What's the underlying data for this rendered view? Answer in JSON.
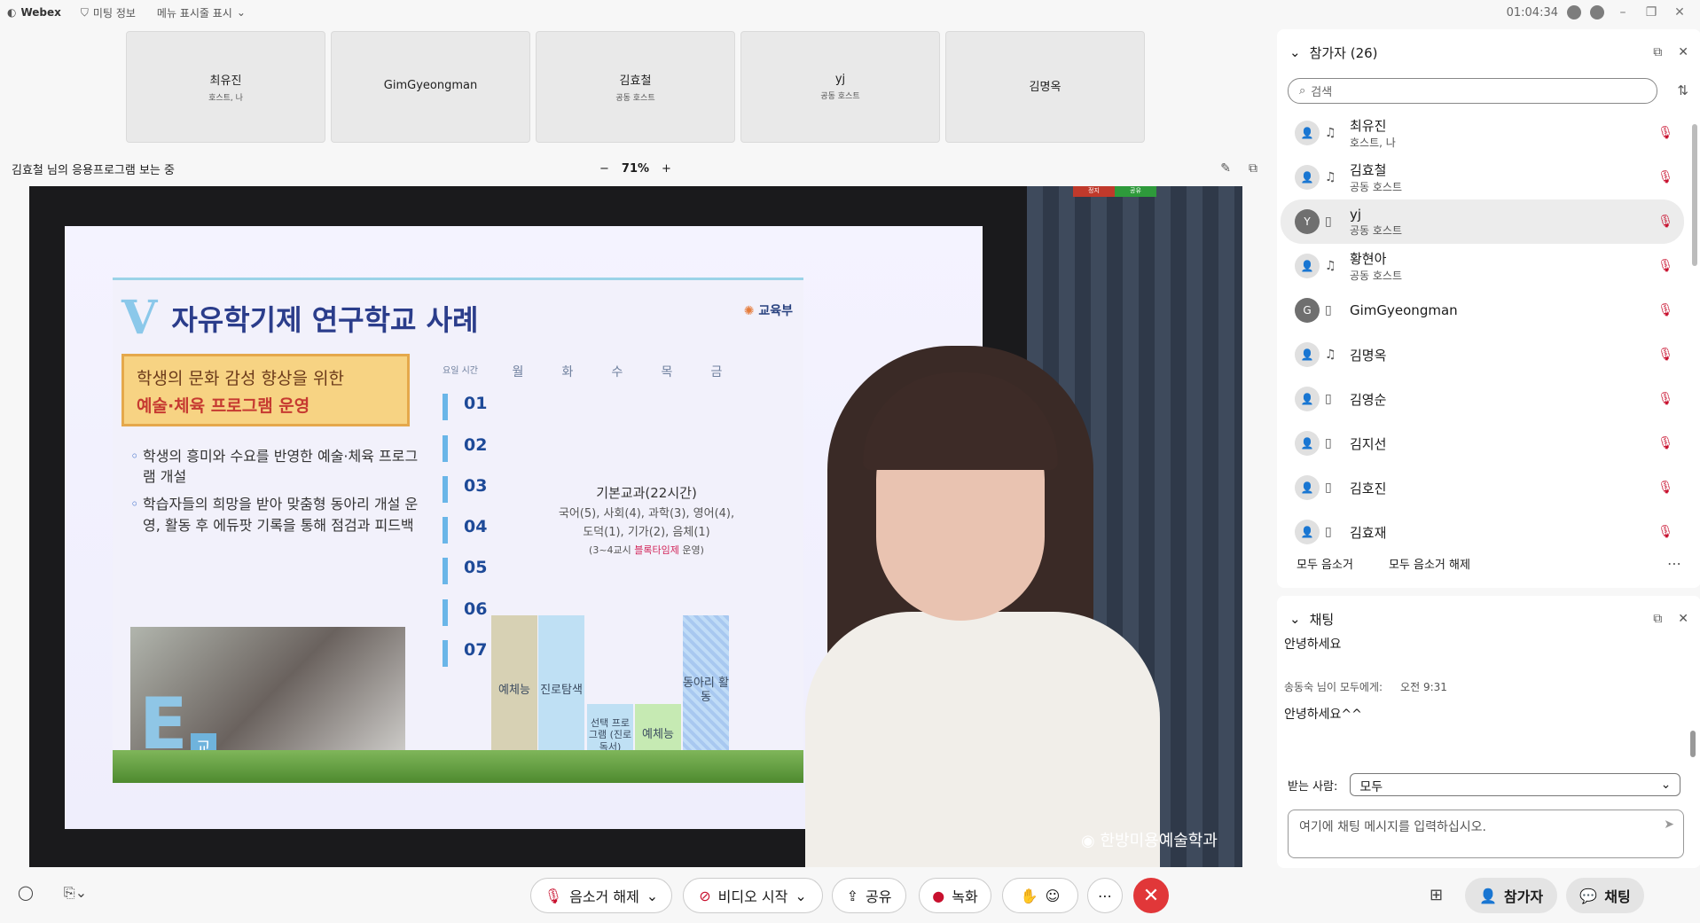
{
  "titlebar": {
    "app": "Webex",
    "meeting_info": "미팅 정보",
    "menu": "메뉴 표시줄 표시",
    "time": "01:04:34"
  },
  "tiles": [
    {
      "name": "최유진",
      "role": "호스트, 나"
    },
    {
      "name": "GimGyeongman",
      "role": ""
    },
    {
      "name": "김효철",
      "role": "공동 호스트"
    },
    {
      "name": "yj",
      "role": "공동 호스트"
    },
    {
      "name": "김명옥",
      "role": ""
    }
  ],
  "share": {
    "title": "김효철 님의 응용프로그램 보는 중",
    "zoom_minus": "−",
    "zoom": "71%",
    "zoom_plus": "+"
  },
  "slide": {
    "v": "V",
    "heading": "자유학기제 연구학교 사례",
    "logo": "교육부",
    "box_line1": "학생의 문화 감성 향상을 위한",
    "box_line2": "예술·체육 프로그램 운영",
    "bullets": [
      "학생의 흥미와 수요를 반영한 예술·체육 프로그램 개설",
      "학습자들의 희망을 받아 맞춤형 동아리 개설 운영, 활동 후 에듀팟 기록을 통해 점검과 피드백"
    ],
    "grid_corner": "요일 시간",
    "days": [
      "월",
      "화",
      "수",
      "목",
      "금"
    ],
    "periods": [
      "01",
      "02",
      "03",
      "04",
      "05",
      "06",
      "07"
    ],
    "core_title": "기본교과(22시간)",
    "core_line1": "국어(5), 사회(4), 과학(3), 영어(4),",
    "core_line2": "도덕(1), 기가(2), 음체(1)",
    "core_note_a": "(3~4교시 ",
    "core_note_red": "블록타임제",
    "core_note_b": " 운영)",
    "blocks": [
      "예체능",
      "진로탐색",
      "선택 프로그램 (진로독서)",
      "예체능",
      "동아리 활동"
    ],
    "photo_letter": "E",
    "photo_badge": "교"
  },
  "recording_mini": [
    "정지",
    "공유"
  ],
  "caption": "한방미용예술학과",
  "participants": {
    "header": "참가자 (26)",
    "search_placeholder": "검색",
    "list": [
      {
        "name": "최유진",
        "role": "호스트, 나",
        "avatar": "",
        "device": "headset"
      },
      {
        "name": "김효철",
        "role": "공동 호스트",
        "avatar": "",
        "device": "headset"
      },
      {
        "name": "yj",
        "role": "공동 호스트",
        "avatar": "Y",
        "device": "phone"
      },
      {
        "name": "황현아",
        "role": "공동 호스트",
        "avatar": "",
        "device": "headset"
      },
      {
        "name": "GimGyeongman",
        "role": "",
        "avatar": "G",
        "device": "phone"
      },
      {
        "name": "김명옥",
        "role": "",
        "avatar": "",
        "device": "headset"
      },
      {
        "name": "김영순",
        "role": "",
        "avatar": "",
        "device": "phone"
      },
      {
        "name": "김지선",
        "role": "",
        "avatar": "",
        "device": "phone"
      },
      {
        "name": "김호진",
        "role": "",
        "avatar": "",
        "device": "phone"
      },
      {
        "name": "김효재",
        "role": "",
        "avatar": "",
        "device": "phone"
      }
    ],
    "mute_all": "모두 음소거",
    "unmute_all": "모두 음소거 해제"
  },
  "chat": {
    "header": "채팅",
    "msg1": "안녕하세요",
    "sender": "송동숙 님이 모두에게:",
    "time": "오전 9:31",
    "msg2": "안녕하세요^^",
    "to_label": "받는 사람:",
    "to_value": "모두",
    "input_placeholder": "여기에 채팅 메시지를 입력하십시오."
  },
  "toolbar": {
    "unmute": "음소거 해제",
    "video": "비디오 시작",
    "share": "공유",
    "record": "녹화",
    "participants": "참가자",
    "chat": "채팅"
  },
  "colors": {
    "accent_red": "#c8102e",
    "end_red": "#e13739",
    "slide_title": "#2b3d8b"
  }
}
